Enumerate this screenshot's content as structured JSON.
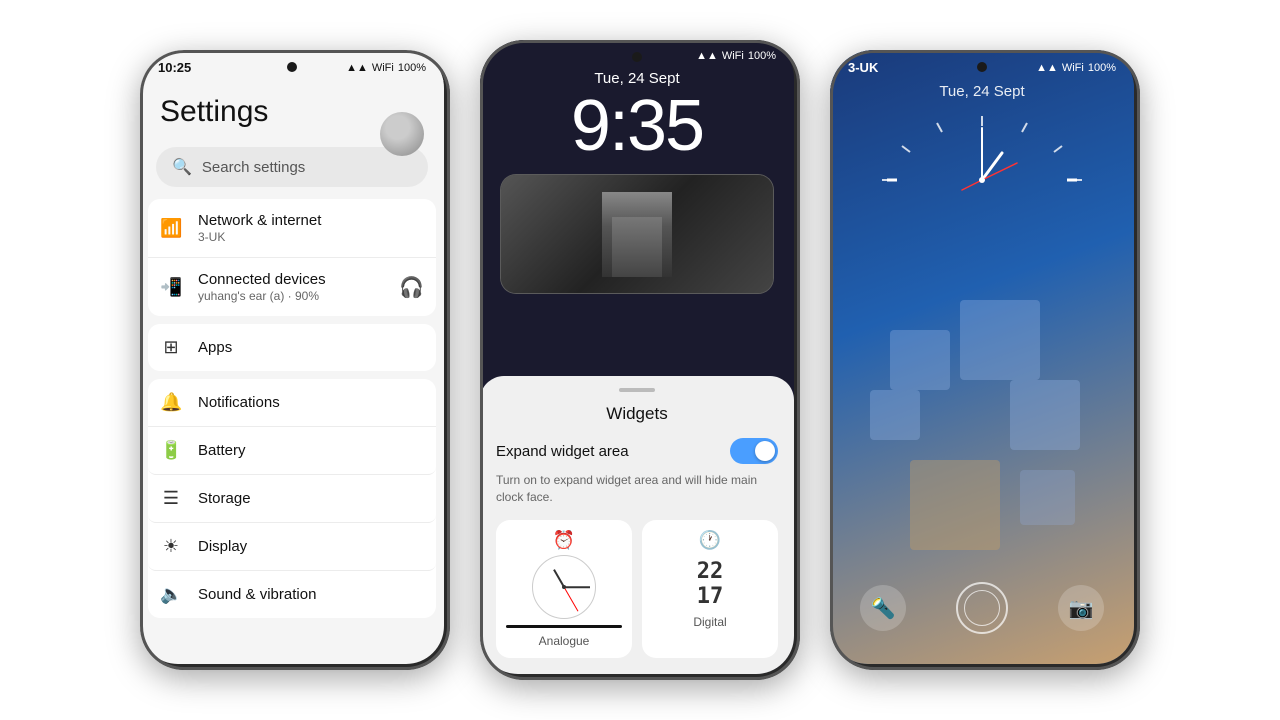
{
  "phone1": {
    "statusBar": {
      "time": "10:25",
      "battery": "100%"
    },
    "title": "Settings",
    "search": {
      "placeholder": "Search settings"
    },
    "items": [
      {
        "id": "network",
        "icon": "wifi",
        "title": "Network & internet",
        "subtitle": "3-UK"
      },
      {
        "id": "devices",
        "icon": "devices",
        "title": "Connected devices",
        "subtitle": "yuhang's ear (a) · 90%"
      },
      {
        "id": "apps",
        "icon": "apps",
        "title": "Apps",
        "subtitle": ""
      },
      {
        "id": "notifications",
        "icon": "bell",
        "title": "Notifications",
        "subtitle": ""
      },
      {
        "id": "battery",
        "icon": "battery",
        "title": "Battery",
        "subtitle": ""
      },
      {
        "id": "storage",
        "icon": "storage",
        "title": "Storage",
        "subtitle": ""
      },
      {
        "id": "display",
        "icon": "display",
        "title": "Display",
        "subtitle": ""
      },
      {
        "id": "sound",
        "icon": "sound",
        "title": "Sound & vibration",
        "subtitle": ""
      }
    ]
  },
  "phone2": {
    "statusBar": {
      "carrier": "",
      "battery": "100%"
    },
    "date": "Tue, 24 Sept",
    "time": "9:35",
    "sheet": {
      "title": "Widgets",
      "expandLabel": "Expand widget area",
      "description": "Turn on to expand widget area and will hide main clock face.",
      "widgetOptions": [
        {
          "type": "analogue",
          "label": "Analogue"
        },
        {
          "type": "digital",
          "label": "Digital"
        }
      ]
    }
  },
  "phone3": {
    "statusBar": {
      "carrier": "3-UK",
      "battery": "100%"
    },
    "date": "Tue, 24 Sept",
    "bottomButtons": {
      "flashlight": "🔦",
      "camera": "📷"
    }
  }
}
